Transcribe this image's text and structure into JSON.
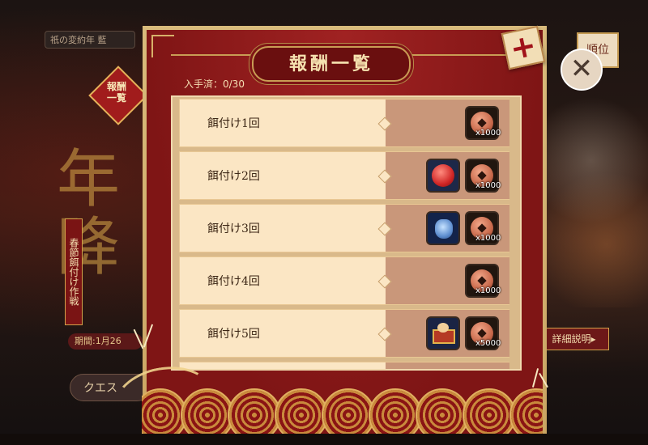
{
  "background": {
    "top_pill_text": "祇の変約年 藍",
    "tag_text": "報酬 一覧",
    "big_title_chars": [
      "年",
      "降"
    ],
    "side_banner_text": "春節餌付け作戦",
    "period_text": "期間:1月26",
    "quest_button": "クエス",
    "rank_button": "順位",
    "detail_button": "詳細説明▸",
    "close_icon_glyph": "✕"
  },
  "modal": {
    "title": "報酬一覧",
    "obtained_label": "入手済：0/30",
    "close_glyph": "+",
    "rows": [
      {
        "label": "餌付け1回",
        "items": [
          {
            "icon": "copper-coin-icon",
            "qty": "x1000"
          }
        ]
      },
      {
        "label": "餌付け2回",
        "items": [
          {
            "icon": "red-orb-icon",
            "qty": ""
          },
          {
            "icon": "copper-coin-icon",
            "qty": "x1000"
          }
        ]
      },
      {
        "label": "餌付け3回",
        "items": [
          {
            "icon": "blue-bag-icon",
            "qty": ""
          },
          {
            "icon": "copper-coin-icon",
            "qty": "x1000"
          }
        ]
      },
      {
        "label": "餌付け4回",
        "items": [
          {
            "icon": "copper-coin-icon",
            "qty": "x1000"
          }
        ]
      },
      {
        "label": "餌付け5回",
        "items": [
          {
            "icon": "character-chest-icon",
            "qty": ""
          },
          {
            "icon": "copper-coin-icon",
            "qty": "x5000"
          }
        ]
      },
      {
        "label": "",
        "items": [
          {
            "icon": "copper-coin-icon",
            "qty": ""
          }
        ]
      }
    ]
  },
  "colors": {
    "panel_red": "#8f1b1b",
    "gold_border": "#d9bb7c",
    "row_bg": "#fbe6c4",
    "reward_bg": "#c9977a"
  }
}
